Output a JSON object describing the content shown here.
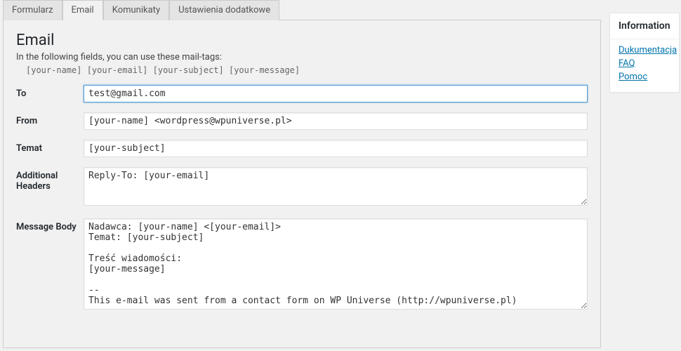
{
  "tabs": [
    {
      "label": "Formularz"
    },
    {
      "label": "Email"
    },
    {
      "label": "Komunikaty"
    },
    {
      "label": "Ustawienia dodatkowe"
    }
  ],
  "heading": "Email",
  "description": "In the following fields, you can use these mail-tags:",
  "mail_tags": "[your-name] [your-email] [your-subject] [your-message]",
  "fields": {
    "to": {
      "label": "To",
      "value": "test@gmail.com"
    },
    "from": {
      "label": "From",
      "value": "[your-name] <wordpress@wpuniverse.pl>"
    },
    "subject": {
      "label": "Temat",
      "value": "[your-subject]"
    },
    "additional_headers": {
      "label": "Additional Headers",
      "value": "Reply-To: [your-email]"
    },
    "body": {
      "label": "Message Body",
      "value": "Nadawca: [your-name] <[your-email]>\nTemat: [your-subject]\n\nTreść wiadomości:\n[your-message]\n\n--\nThis e-mail was sent from a contact form on WP Universe (http://wpuniverse.pl)"
    }
  },
  "sidebar": {
    "title": "Information",
    "links": [
      {
        "label": "Dukumentacja"
      },
      {
        "label": "FAQ"
      },
      {
        "label": "Pomoc"
      }
    ]
  }
}
